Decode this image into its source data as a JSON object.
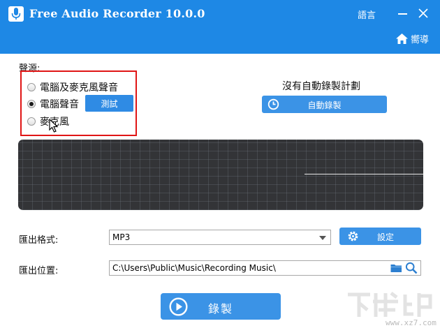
{
  "titlebar": {
    "app_title": "Free Audio Recorder 10.0.0",
    "language_label": "語言",
    "guide_label": "嚮導"
  },
  "sound_source": {
    "label": "聲源:",
    "options": [
      {
        "label": "電腦及麥克風聲音",
        "checked": false
      },
      {
        "label": "電腦聲音",
        "checked": true
      },
      {
        "label": "麥克風",
        "checked": false
      }
    ],
    "test_button": "測試"
  },
  "schedule": {
    "status_text": "沒有自動錄製計劃",
    "auto_record_button": "自動錄製"
  },
  "export_format": {
    "label": "匯出格式:",
    "value": "MP3",
    "settings_button": "設定"
  },
  "export_location": {
    "label": "匯出位置:",
    "value": "C:\\Users\\Public\\Music\\Recording Music\\"
  },
  "record_button": "錄製",
  "watermark": {
    "text": "www.xz7.com"
  },
  "colors": {
    "accent": "#1e88e5",
    "button": "#3b93e6",
    "highlight_box": "#e01515",
    "waveform_bg": "#333437"
  }
}
